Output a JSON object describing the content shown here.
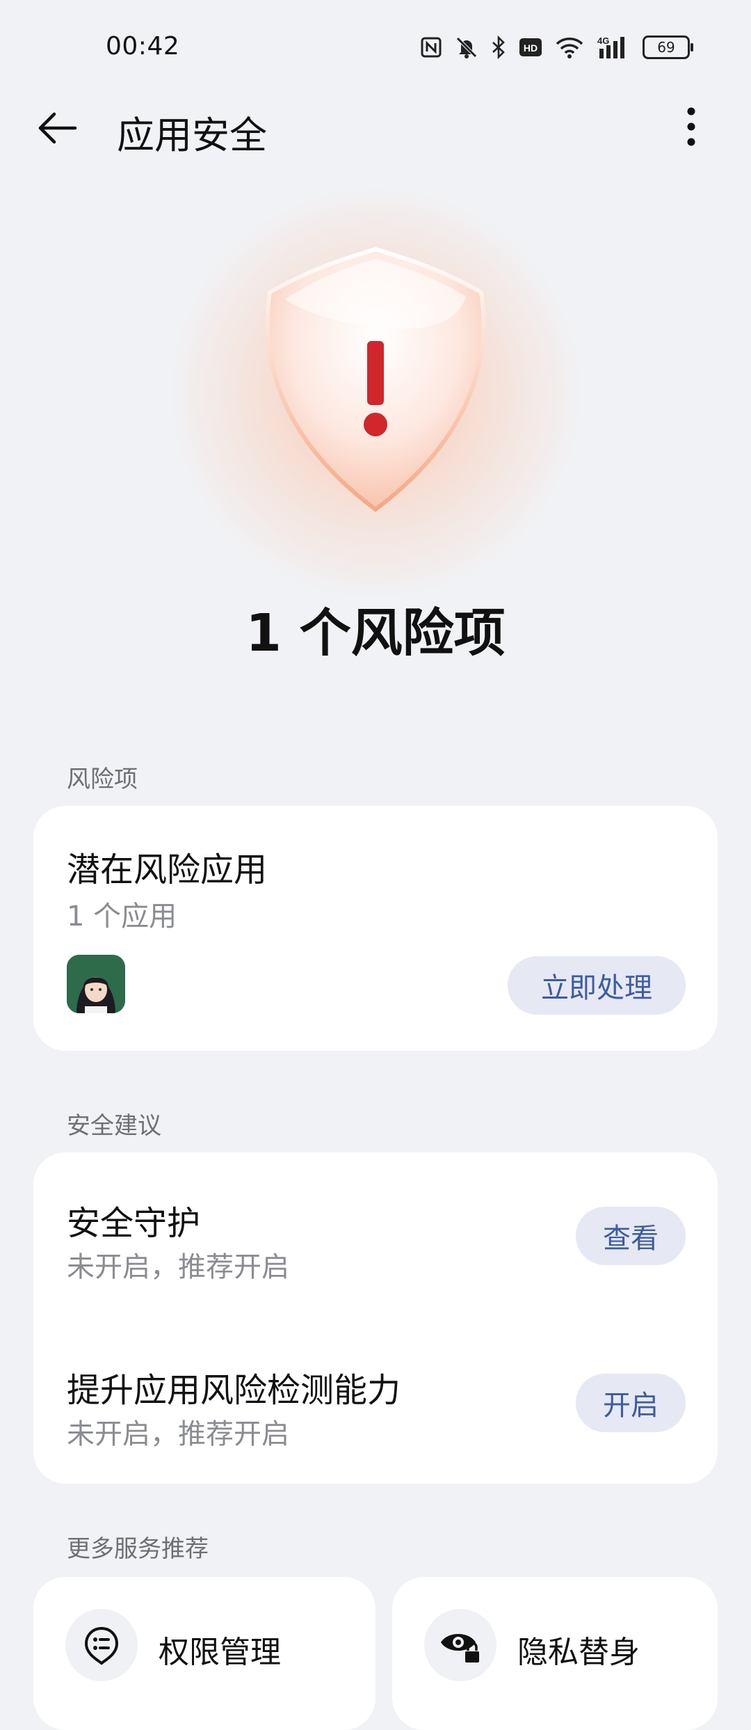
{
  "status_bar": {
    "time": "00:42",
    "battery": "69",
    "network": "4G",
    "icons": [
      "nfc-icon",
      "mute-icon",
      "bluetooth-icon",
      "hd-icon",
      "wifi-icon",
      "signal-icon",
      "battery-icon"
    ]
  },
  "header": {
    "title": "应用安全",
    "back_icon": "back-arrow-icon",
    "more_icon": "more-vertical-icon"
  },
  "hero": {
    "title": "1 个风险项",
    "icon": "shield-warning-icon"
  },
  "sections": {
    "risk_label": "风险项",
    "advice_label": "安全建议",
    "more_label": "更多服务推荐"
  },
  "risk_card": {
    "title": "潜在风险应用",
    "subtitle": "1 个应用",
    "action": "立即处理"
  },
  "advice": [
    {
      "title": "安全守护",
      "subtitle": "未开启，推荐开启",
      "action": "查看"
    },
    {
      "title": "提升应用风险检测能力",
      "subtitle": "未开启，推荐开启",
      "action": "开启"
    }
  ],
  "services": [
    {
      "label": "权限管理",
      "icon": "permission-icon"
    },
    {
      "label": "隐私替身",
      "icon": "privacy-eye-lock-icon"
    }
  ],
  "colors": {
    "background": "#f1f2f5",
    "card": "#ffffff",
    "accent": "#3c5d9f",
    "pill_bg": "#e6e8f4",
    "warning": "#d1262b"
  }
}
